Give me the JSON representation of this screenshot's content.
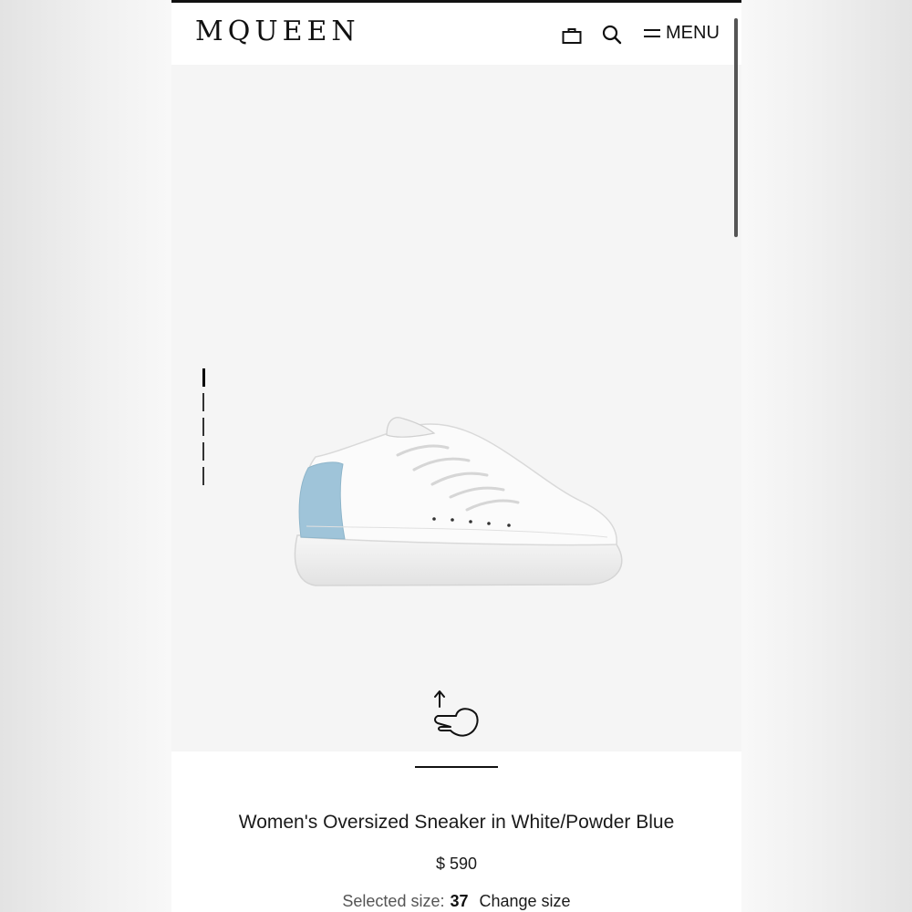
{
  "brand": {
    "logo_text": "MQUEEN"
  },
  "header": {
    "icons": [
      "shopping-bag-icon",
      "search-icon",
      "menu-icon"
    ],
    "menu_label": "MENU"
  },
  "gallery": {
    "image_count": 5,
    "active_index": 0,
    "product_image": "white-sneaker-powder-blue-heel",
    "gesture_icon": "swipe-up-hand-icon",
    "accent_color": "#9fc4d9"
  },
  "product": {
    "title": "Women's Oversized Sneaker in White/Powder Blue",
    "price": "$ 590",
    "selected_size_label": "Selected size:",
    "selected_size_value": "37",
    "change_size_label": "Change size"
  }
}
